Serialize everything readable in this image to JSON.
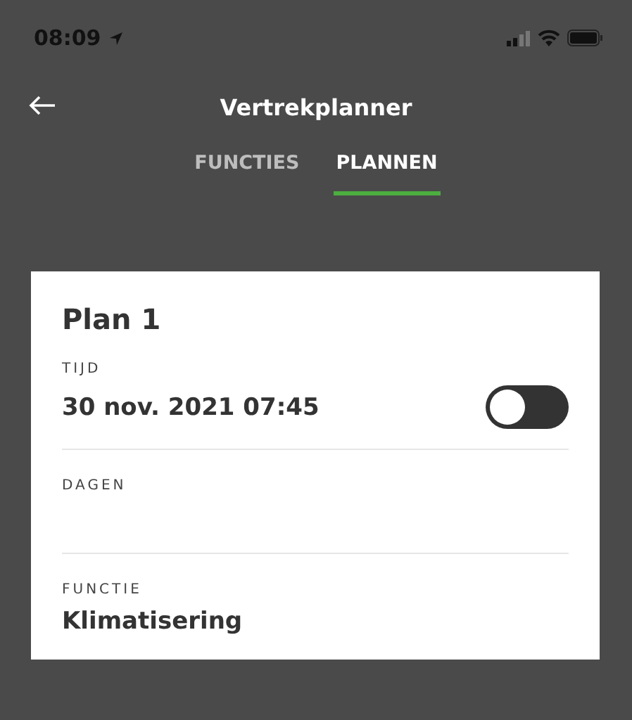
{
  "status_bar": {
    "time": "08:09"
  },
  "header": {
    "title": "Vertrekplanner"
  },
  "tabs": [
    {
      "label": "FUNCTIES",
      "selected": false
    },
    {
      "label": "PLANNEN",
      "selected": true
    }
  ],
  "plan": {
    "title": "Plan 1",
    "fields": [
      {
        "label": "TIJD",
        "value": "30 nov. 2021 07:45",
        "kind": "toggle",
        "on": false
      },
      {
        "label": "DAGEN",
        "kind": "text"
      },
      {
        "label": "FUNCTIE",
        "value": "Klimatisering",
        "kind": "text"
      }
    ]
  }
}
